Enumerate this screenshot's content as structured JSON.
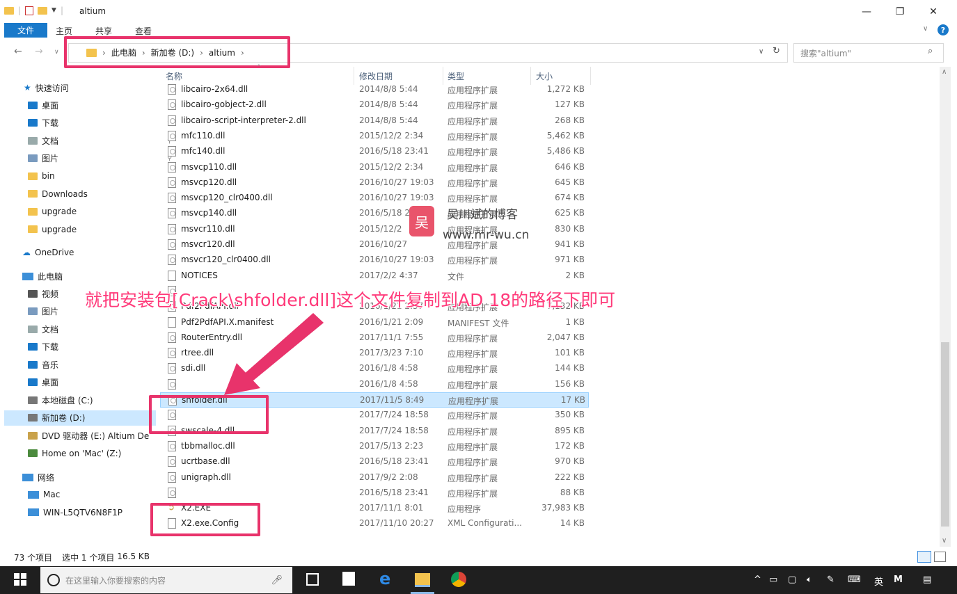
{
  "window": {
    "title": "altium",
    "controls": {
      "minimize": "—",
      "restore": "❐",
      "close": "✕"
    }
  },
  "ribbon": {
    "tabs": [
      "文件",
      "主页",
      "共享",
      "查看"
    ]
  },
  "address": {
    "crumbs": [
      "此电脑",
      "新加卷 (D:)",
      "altium"
    ],
    "search_placeholder": "搜索\"altium\""
  },
  "nav": {
    "quick_access": "快速访问",
    "quick_items": [
      {
        "label": "桌面",
        "icon": "desktop-icon",
        "pinned": true
      },
      {
        "label": "下载",
        "icon": "download-icon",
        "pinned": true
      },
      {
        "label": "文档",
        "icon": "document-icon",
        "pinned": true
      },
      {
        "label": "图片",
        "icon": "picture-icon",
        "pinned": true
      },
      {
        "label": "bin",
        "icon": "folder-icon",
        "pinned": false
      },
      {
        "label": "Downloads",
        "icon": "folder-icon",
        "pinned": false
      },
      {
        "label": "upgrade",
        "icon": "folder-icon",
        "pinned": false
      },
      {
        "label": "upgrade",
        "icon": "folder-icon",
        "pinned": false
      }
    ],
    "onedrive": "OneDrive",
    "this_pc": "此电脑",
    "pc_items": [
      {
        "label": "视频",
        "icon": "video-icon"
      },
      {
        "label": "图片",
        "icon": "picture-icon"
      },
      {
        "label": "文档",
        "icon": "document-icon"
      },
      {
        "label": "下载",
        "icon": "download-icon"
      },
      {
        "label": "音乐",
        "icon": "music-icon"
      },
      {
        "label": "桌面",
        "icon": "desktop-icon"
      },
      {
        "label": "本地磁盘 (C:)",
        "icon": "drive-icon"
      },
      {
        "label": "新加卷 (D:)",
        "icon": "drive-icon",
        "selected": true
      },
      {
        "label": "DVD 驱动器 (E:) Altium De",
        "icon": "dvd-icon"
      },
      {
        "label": "Home on 'Mac' (Z:)",
        "icon": "network-drive-icon"
      }
    ],
    "network": "网络",
    "network_items": [
      "Mac",
      "WIN-L5QTV6N8F1P"
    ]
  },
  "columns": {
    "name": "名称",
    "date": "修改日期",
    "type": "类型",
    "size": "大小"
  },
  "files": [
    {
      "name": "libcairo-2x64.dll",
      "date": "2014/8/8 5:44",
      "type": "应用程序扩展",
      "size": "1,272 KB",
      "icon": "dll"
    },
    {
      "name": "libcairo-gobject-2.dll",
      "date": "2014/8/8 5:44",
      "type": "应用程序扩展",
      "size": "127 KB",
      "icon": "dll"
    },
    {
      "name": "libcairo-script-interpreter-2.dll",
      "date": "2014/8/8 5:44",
      "type": "应用程序扩展",
      "size": "268 KB",
      "icon": "dll"
    },
    {
      "name": "mfc110.dll",
      "date": "2015/12/2 2:34",
      "type": "应用程序扩展",
      "size": "5,462 KB",
      "icon": "dll"
    },
    {
      "name": "mfc140.dll",
      "date": "2016/5/18 23:41",
      "type": "应用程序扩展",
      "size": "5,486 KB",
      "icon": "dll"
    },
    {
      "name": "msvcp110.dll",
      "date": "2015/12/2 2:34",
      "type": "应用程序扩展",
      "size": "646 KB",
      "icon": "dll"
    },
    {
      "name": "msvcp120.dll",
      "date": "2016/10/27 19:03",
      "type": "应用程序扩展",
      "size": "645 KB",
      "icon": "dll"
    },
    {
      "name": "msvcp120_clr0400.dll",
      "date": "2016/10/27 19:03",
      "type": "应用程序扩展",
      "size": "674 KB",
      "icon": "dll"
    },
    {
      "name": "msvcp140.dll",
      "date": "2016/5/18 2",
      "type": "应用程序扩展",
      "size": "625 KB",
      "icon": "dll"
    },
    {
      "name": "msvcr110.dll",
      "date": "2015/12/2",
      "type": "应用程序扩展",
      "size": "830 KB",
      "icon": "dll"
    },
    {
      "name": "msvcr120.dll",
      "date": "2016/10/27",
      "type": "应用程序扩展",
      "size": "941 KB",
      "icon": "dll"
    },
    {
      "name": "msvcr120_clr0400.dll",
      "date": "2016/10/27 19:03",
      "type": "应用程序扩展",
      "size": "971 KB",
      "icon": "dll"
    },
    {
      "name": "NOTICES",
      "date": "2017/2/2 4:37",
      "type": "文件",
      "size": "2 KB",
      "icon": "plain"
    },
    {
      "name": "",
      "date": "",
      "type": "",
      "size": "",
      "icon": "dll"
    },
    {
      "name": "Pdf2PdfAPI.dll",
      "date": "2016/1/21 2:37",
      "type": "应用程序扩展",
      "size": "7,132 KB",
      "icon": "dll"
    },
    {
      "name": "Pdf2PdfAPI.X.manifest",
      "date": "2016/1/21 2:09",
      "type": "MANIFEST 文件",
      "size": "1 KB",
      "icon": "plain"
    },
    {
      "name": "RouterEntry.dll",
      "date": "2017/11/1 7:55",
      "type": "应用程序扩展",
      "size": "2,047 KB",
      "icon": "dll"
    },
    {
      "name": "rtree.dll",
      "date": "2017/3/23 7:10",
      "type": "应用程序扩展",
      "size": "101 KB",
      "icon": "dll"
    },
    {
      "name": "sdi.dll",
      "date": "2016/1/8 4:58",
      "type": "应用程序扩展",
      "size": "144 KB",
      "icon": "dll"
    },
    {
      "name": "",
      "date": "2016/1/8 4:58",
      "type": "应用程序扩展",
      "size": "156 KB",
      "icon": "dll"
    },
    {
      "name": "shfolder.dll",
      "date": "2017/11/5 8:49",
      "type": "应用程序扩展",
      "size": "17 KB",
      "icon": "dll",
      "selected": true
    },
    {
      "name": "",
      "date": "2017/7/24 18:58",
      "type": "应用程序扩展",
      "size": "350 KB",
      "icon": "dll"
    },
    {
      "name": "swscale-4.dll",
      "date": "2017/7/24 18:58",
      "type": "应用程序扩展",
      "size": "895 KB",
      "icon": "dll"
    },
    {
      "name": "tbbmalloc.dll",
      "date": "2017/5/13 2:23",
      "type": "应用程序扩展",
      "size": "172 KB",
      "icon": "dll"
    },
    {
      "name": "ucrtbase.dll",
      "date": "2016/5/18 23:41",
      "type": "应用程序扩展",
      "size": "970 KB",
      "icon": "dll"
    },
    {
      "name": "unigraph.dll",
      "date": "2017/9/2 2:08",
      "type": "应用程序扩展",
      "size": "222 KB",
      "icon": "dll"
    },
    {
      "name": "",
      "date": "2016/5/18 23:41",
      "type": "应用程序扩展",
      "size": "88 KB",
      "icon": "dll"
    },
    {
      "name": "X2.EXE",
      "date": "2017/11/1 8:01",
      "type": "应用程序",
      "size": "37,983 KB",
      "icon": "exe"
    },
    {
      "name": "X2.exe.Config",
      "date": "2017/11/10 20:27",
      "type": "XML Configurati...",
      "size": "14 KB",
      "icon": "config"
    }
  ],
  "status": {
    "count": "73 个项目",
    "selected": "选中 1 个项目",
    "size": "16.5 KB"
  },
  "taskbar": {
    "search_placeholder": "在这里输入你要搜索的内容",
    "ime": "英",
    "ime2": "M"
  },
  "annotation": {
    "instruction": "就把安装包[Crack\\shfolder.dll]这个文件复制到AD 18的路径下即可",
    "color": "#e8336b"
  },
  "watermark": {
    "logo": "吴",
    "name": "吴川斌的博客",
    "url": "www.mr-wu.cn"
  }
}
